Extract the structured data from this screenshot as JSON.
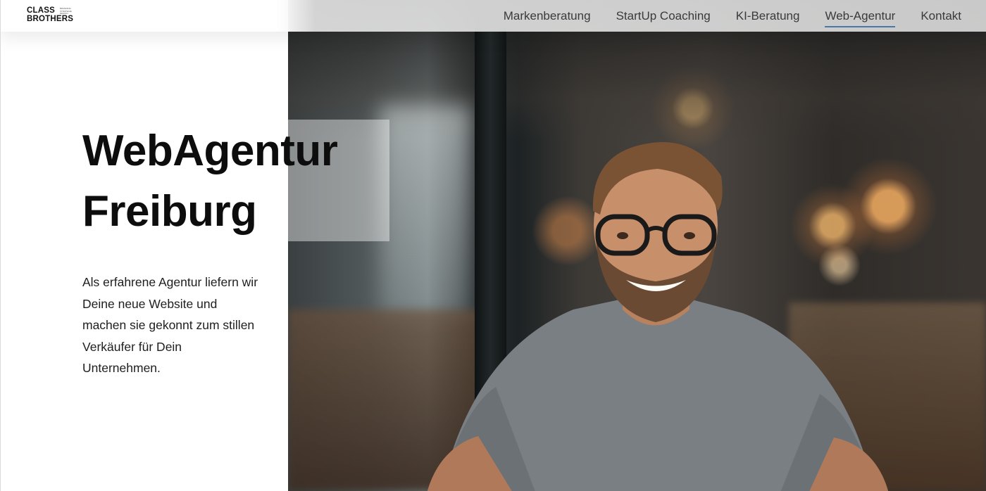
{
  "logo": {
    "line1": "CLASS",
    "line2": "BROTHERS",
    "tagline": "BRANDING STRATEGIE DESIGN"
  },
  "nav": {
    "items": [
      {
        "label": "Markenberatung"
      },
      {
        "label": "StartUp Coaching"
      },
      {
        "label": "KI-Beratung"
      },
      {
        "label": "Web-Agentur",
        "active": true
      },
      {
        "label": "Kontakt"
      }
    ]
  },
  "hero": {
    "title_line1": "WebAgentur",
    "title_line2": "Freiburg",
    "text": "Als erfahrene Agentur liefern wir Deine neue Website und machen sie gekonnt zum stillen Verkäufer für Dein Unternehmen."
  },
  "colors": {
    "accent_underline": "#4a78a8",
    "title": "#0d0d0d",
    "text": "#1e1e1e"
  },
  "icons": [
    "brand-logo-icon"
  ]
}
